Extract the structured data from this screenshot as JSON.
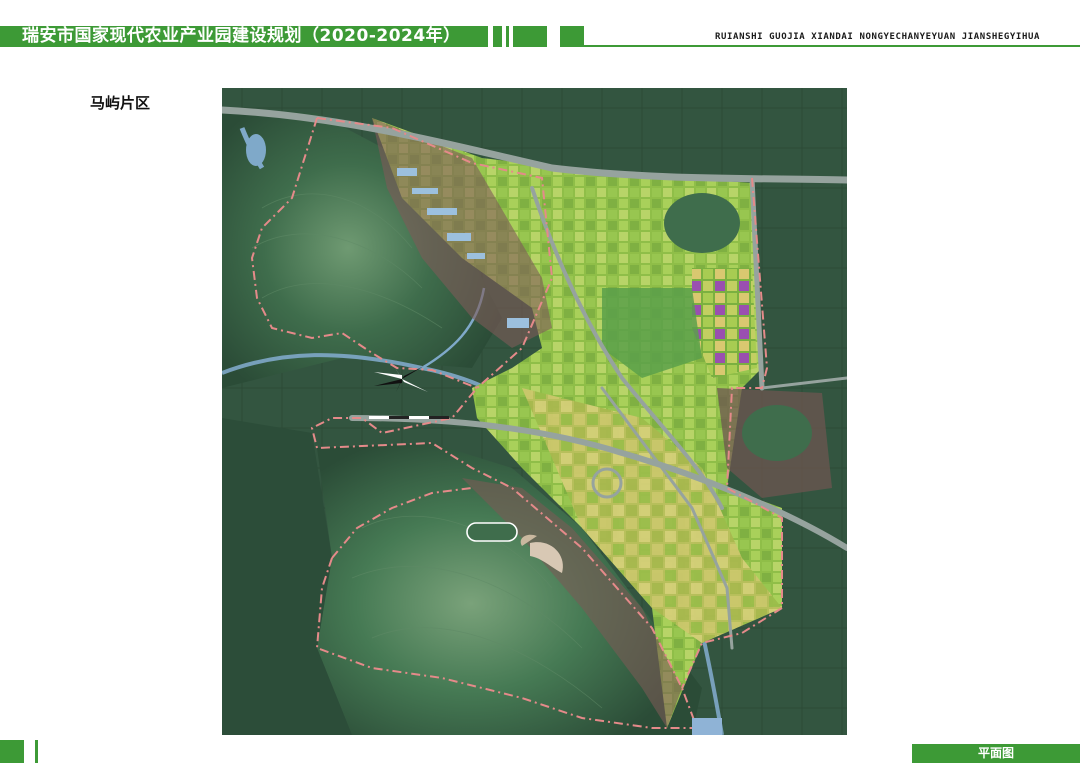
{
  "header": {
    "title": "瑞安市国家现代农业产业园建设规划（2020-2024年）",
    "subtitle": "RUIANSHI GUOJIA XIANDAI NONGYECHANYEYUAN JIANSHEGYIHUA"
  },
  "district_label": "马屿片区",
  "footer": {
    "tag": "平面图"
  },
  "colors": {
    "brand_green": "#3d9a36",
    "mountain": "#2e5a3e",
    "field_green": "#9ec84e",
    "field_yellow": "#c8c46a",
    "water": "#8fb6d8",
    "road": "#8a9a93",
    "boundary": "#e58a8a"
  }
}
